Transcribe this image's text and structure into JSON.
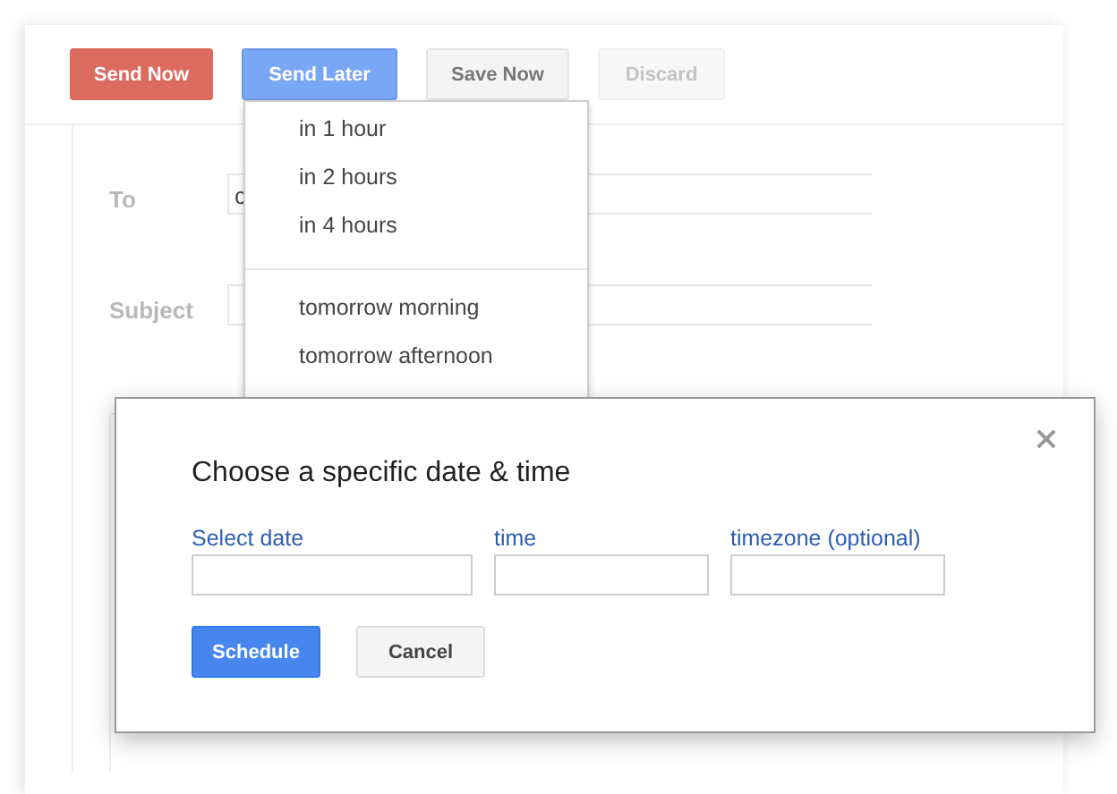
{
  "toolbar": {
    "buttons": [
      {
        "label": "Send Now",
        "kind": "danger"
      },
      {
        "label": "Send Later",
        "kind": "primary"
      },
      {
        "label": "Save Now",
        "kind": "default"
      },
      {
        "label": "Discard",
        "kind": "disabled"
      }
    ]
  },
  "compose": {
    "to": {
      "label": "To",
      "value": "c"
    },
    "subject": {
      "label": "Subject"
    }
  },
  "send_later_menu": {
    "groups": [
      [
        "in 1 hour",
        "in 2 hours",
        "in 4 hours"
      ],
      [
        "tomorrow morning",
        "tomorrow afternoon"
      ]
    ]
  },
  "dialog": {
    "title": "Choose a specific date & time",
    "fields": [
      {
        "label": "Select date"
      },
      {
        "label": "time"
      },
      {
        "label": "timezone (optional)"
      }
    ],
    "buttons": [
      {
        "label": "Schedule",
        "kind": "primary"
      },
      {
        "label": "Cancel",
        "kind": "default"
      }
    ]
  }
}
